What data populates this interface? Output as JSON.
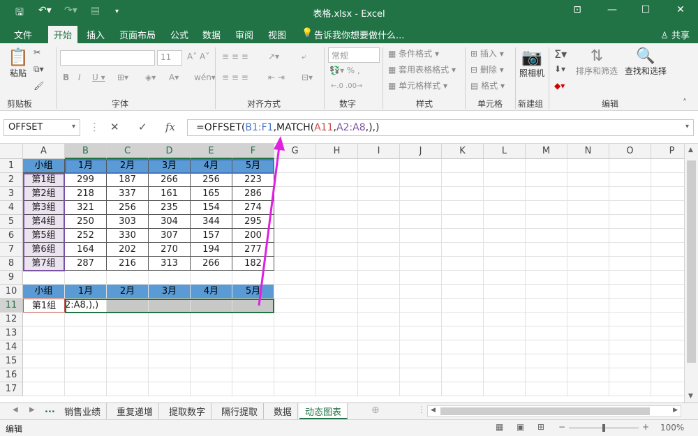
{
  "title_bar": {
    "title": "表格.xlsx - Excel"
  },
  "menu": {
    "items": [
      "文件",
      "开始",
      "插入",
      "页面布局",
      "公式",
      "数据",
      "审阅",
      "视图"
    ],
    "active": "开始",
    "tell_me": "告诉我你想要做什么...",
    "share": "共享"
  },
  "ribbon": {
    "clipboard": {
      "paste": "粘贴",
      "label": "剪贴板"
    },
    "font": {
      "size": "11",
      "label": "字体"
    },
    "alignment": {
      "label": "对齐方式"
    },
    "number": {
      "format": "常规",
      "label": "数字"
    },
    "styles": {
      "conditional": "条件格式",
      "table": "套用表格格式",
      "cell": "单元格样式",
      "label": "样式"
    },
    "cells": {
      "insert": "插入",
      "delete": "删除",
      "format": "格式",
      "label": "单元格"
    },
    "camera": {
      "camera": "照相机",
      "label": "新建组"
    },
    "editing": {
      "sort": "排序和筛选",
      "find": "查找和选择",
      "label": "编辑"
    }
  },
  "formula_bar": {
    "name_box": "OFFSET",
    "prefix": "=OFFSET(",
    "ref1": "B1:F1",
    "mid": ",MATCH(",
    "ref2": "A11",
    "comma": ",",
    "ref3": "A2:A8",
    "suffix": ",),)"
  },
  "columns": [
    "A",
    "B",
    "C",
    "D",
    "E",
    "F",
    "G",
    "H",
    "I",
    "J",
    "K",
    "L",
    "M",
    "N",
    "O",
    "P"
  ],
  "rows": [
    "1",
    "2",
    "3",
    "4",
    "5",
    "6",
    "7",
    "8",
    "9",
    "10",
    "11",
    "12",
    "13",
    "14",
    "15",
    "16",
    "17"
  ],
  "table_header": [
    "小组",
    "1月",
    "2月",
    "3月",
    "4月",
    "5月"
  ],
  "table_rows": [
    [
      "第1组",
      "299",
      "187",
      "266",
      "256",
      "223"
    ],
    [
      "第2组",
      "218",
      "337",
      "161",
      "165",
      "286"
    ],
    [
      "第3组",
      "321",
      "256",
      "235",
      "154",
      "274"
    ],
    [
      "第4组",
      "250",
      "303",
      "304",
      "344",
      "295"
    ],
    [
      "第5组",
      "252",
      "330",
      "307",
      "157",
      "200"
    ],
    [
      "第6组",
      "164",
      "202",
      "270",
      "194",
      "277"
    ],
    [
      "第7组",
      "287",
      "216",
      "313",
      "266",
      "182"
    ]
  ],
  "result_header": [
    "小组",
    "1月",
    "2月",
    "3月",
    "4月",
    "5月"
  ],
  "result_row": {
    "group": "第1组",
    "edit_text": "2:A8,),)"
  },
  "sheets": [
    "销售业绩",
    "重复递增",
    "提取数字",
    "隔行提取",
    "数据",
    "动态图表"
  ],
  "active_sheet": "动态图表",
  "status": {
    "mode": "编辑",
    "zoom": "100%"
  },
  "colors": {
    "accent": "#217346",
    "header_fill": "#5b9bd5",
    "arrow": "#e020e0"
  }
}
